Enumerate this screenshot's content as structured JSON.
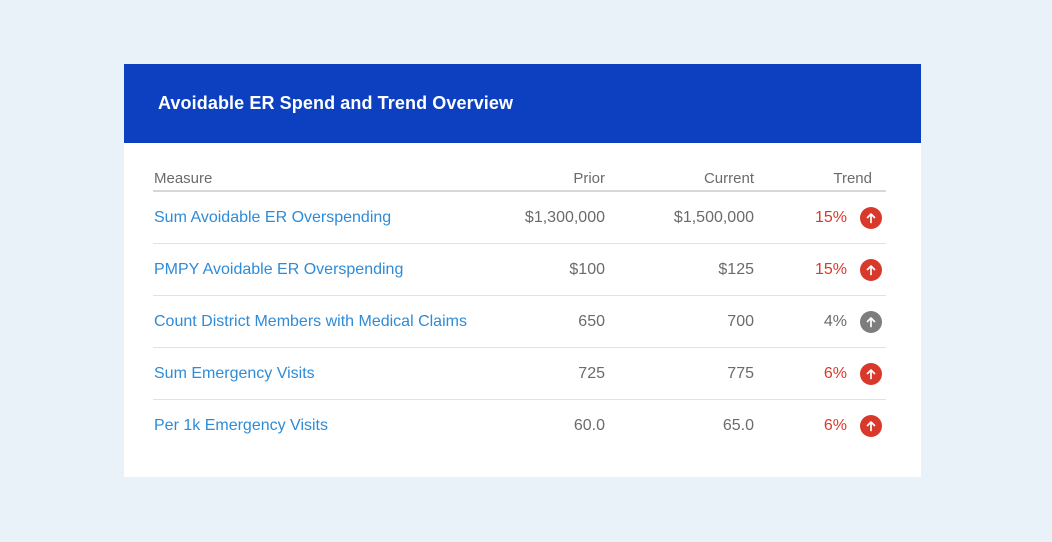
{
  "card": {
    "title": "Avoidable ER Spend and Trend Overview"
  },
  "table": {
    "headers": {
      "measure": "Measure",
      "prior": "Prior",
      "current": "Current",
      "trend": "Trend"
    },
    "rows": [
      {
        "measure": "Sum Avoidable ER Overspending",
        "prior": "$1,300,000",
        "current": "$1,500,000",
        "trend": "15%",
        "trend_icon": "arrow-up-icon"
      },
      {
        "measure": "PMPY Avoidable ER Overspending",
        "prior": "$100",
        "current": "$125",
        "trend": "15%",
        "trend_icon": "arrow-up-icon"
      },
      {
        "measure": "Count District Members with Medical Claims",
        "prior": "650",
        "current": "700",
        "trend": "4%",
        "trend_icon": "arrow-up-icon"
      },
      {
        "measure": "Sum Emergency Visits",
        "prior": "725",
        "current": "775",
        "trend": "6%",
        "trend_icon": "arrow-up-icon"
      },
      {
        "measure": "Per 1k Emergency Visits",
        "prior": "60.0",
        "current": "65.0",
        "trend": "6%",
        "trend_icon": "arrow-up-icon"
      }
    ]
  },
  "colors": {
    "header_background": "#0d40c1",
    "page_background": "#e9f1f9",
    "measure_link": "#2e8bd8",
    "trend_up": "#d9392b",
    "trend_neutral": "#7d7d7d"
  }
}
